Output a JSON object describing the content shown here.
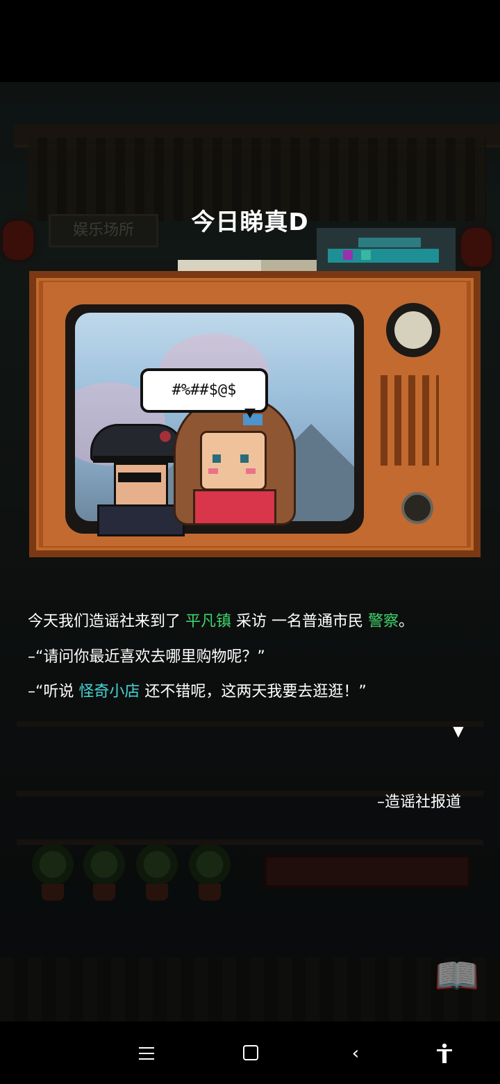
{
  "scene": {
    "shop_sign": "娱乐场所"
  },
  "title": "今日睇真D",
  "tv": {
    "speech_bubble": "#%##$@$"
  },
  "story": {
    "line1": {
      "part1": "今天我们造谣社来到了 ",
      "place": "平凡镇",
      "part2": " 采访 一名普通市民 ",
      "person": "警察",
      "part3": "。"
    },
    "line2": "–“请问你最近喜欢去哪里购物呢？”",
    "line3": {
      "part1": "–“听说 ",
      "shop": "怪奇小店",
      "part2": " 还不错呢，这两天我要去逛逛！”"
    },
    "signature": "–造谣社报道"
  },
  "icons": {
    "continue": "triangle-down-icon",
    "book": "open-book-icon",
    "nav_menu": "menu-icon",
    "nav_home": "square-home-icon",
    "nav_back": "chevron-left-icon",
    "nav_accessibility": "accessibility-icon"
  },
  "colors": {
    "highlight_green": "#3fd46a",
    "highlight_cyan": "#48d6d6",
    "tv_wood": "#a8521e"
  }
}
